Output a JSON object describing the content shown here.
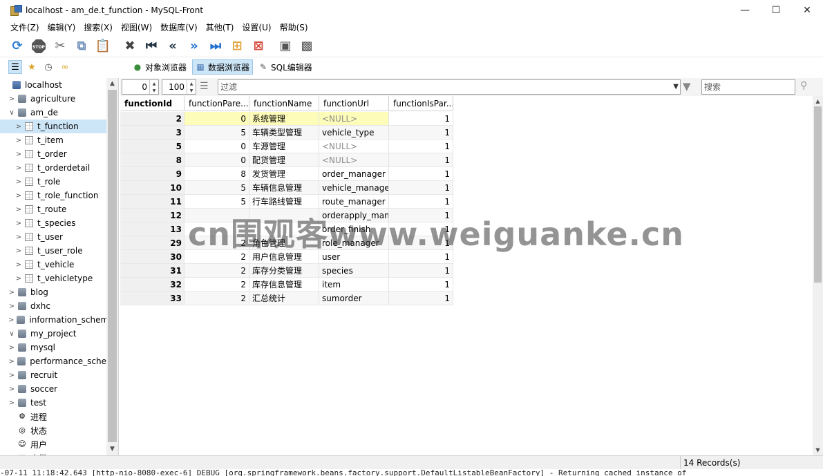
{
  "window": {
    "title": "localhost - am_de.t_function - MySQL-Front"
  },
  "menu": [
    "文件(Z)",
    "编辑(Y)",
    "搜索(X)",
    "视图(W)",
    "数据库(V)",
    "其他(T)",
    "设置(U)",
    "帮助(S)"
  ],
  "toolbar_icons": [
    "refresh-icon",
    "stop-icon",
    "cut-icon",
    "copy-icon",
    "paste-icon",
    "delete-icon",
    "first-icon",
    "prev-icon",
    "next-icon",
    "last-icon",
    "insert-row-icon",
    "delete-row-icon",
    "post-icon",
    "cancel-icon"
  ],
  "view_tabs": [
    {
      "label": "对象浏览器",
      "icon": "object-browser-icon",
      "active": false
    },
    {
      "label": "数据浏览器",
      "icon": "data-browser-icon",
      "active": true
    },
    {
      "label": "SQL编辑器",
      "icon": "sql-editor-icon",
      "active": false
    }
  ],
  "tree": {
    "host": "localhost",
    "databases": [
      "agriculture",
      "am_de",
      "blog",
      "dxhc",
      "information_schem",
      "my_project",
      "mysql",
      "performance_sche",
      "recruit",
      "soccer",
      "test"
    ],
    "am_de_tables": [
      "t_function",
      "t_item",
      "t_order",
      "t_orderdetail",
      "t_role",
      "t_role_function",
      "t_route",
      "t_species",
      "t_user",
      "t_user_role",
      "t_vehicle",
      "t_vehicletype"
    ],
    "selected": "t_function",
    "extras": [
      "进程",
      "状态",
      "用户",
      "变量"
    ]
  },
  "filter": {
    "offset": "0",
    "limit": "100",
    "filter_placeholder": "过滤",
    "search_placeholder": "搜索"
  },
  "grid": {
    "columns": [
      "functionId",
      "functionPare...",
      "functionName",
      "functionUrl",
      "functionIsPar..."
    ],
    "rows": [
      [
        "2",
        "0",
        "系统管理",
        "<NULL>",
        "1"
      ],
      [
        "3",
        "5",
        "车辆类型管理",
        "vehicle_type",
        "1"
      ],
      [
        "5",
        "0",
        "车源管理",
        "<NULL>",
        "1"
      ],
      [
        "8",
        "0",
        "配货管理",
        "<NULL>",
        "1"
      ],
      [
        "9",
        "8",
        "发货管理",
        "order_manager",
        "1"
      ],
      [
        "10",
        "5",
        "车辆信息管理",
        "vehicle_manager",
        "1"
      ],
      [
        "11",
        "5",
        "行车路线管理",
        "route_manager",
        "1"
      ],
      [
        "12",
        "",
        "",
        "orderapply_mana",
        "1"
      ],
      [
        "13",
        "",
        "",
        "order_finish",
        "1"
      ],
      [
        "29",
        "2",
        "角色管理",
        "role_manager",
        "1"
      ],
      [
        "30",
        "2",
        "用户信息管理",
        "user",
        "1"
      ],
      [
        "31",
        "2",
        "库存分类管理",
        "species",
        "1"
      ],
      [
        "32",
        "2",
        "库存信息管理",
        "item",
        "1"
      ],
      [
        "33",
        "2",
        "汇总统计",
        "sumorder",
        "1"
      ]
    ]
  },
  "status": {
    "records": "14 Records(s)"
  },
  "log_line": "-07-11 11:18:42.643 [http-nio-8080-exec-6] DEBUG [org.springframework.beans.factory.support.DefaultListableBeanFactory] - Returning cached instance of",
  "left_edge_chars": "c\n2\n2\n2\n2\n2\n2\n2\n2",
  "watermark": "cn围观客www.weiguanke.cn"
}
